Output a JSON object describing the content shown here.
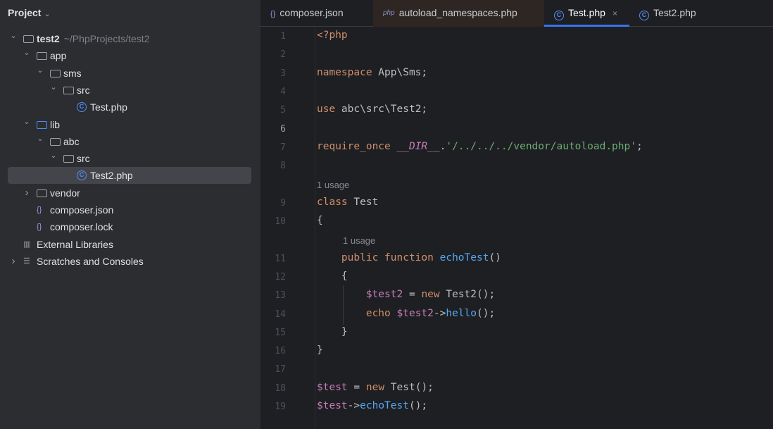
{
  "sidebar": {
    "title": "Project",
    "tree": [
      {
        "label": "test2",
        "hint": "~/PhpProjects/test2",
        "icon": "folder",
        "depth": 0,
        "arrow": "down",
        "bold": true
      },
      {
        "label": "app",
        "icon": "folder",
        "depth": 1,
        "arrow": "down"
      },
      {
        "label": "sms",
        "icon": "folder",
        "depth": 2,
        "arrow": "down"
      },
      {
        "label": "src",
        "icon": "folder",
        "depth": 3,
        "arrow": "down"
      },
      {
        "label": "Test.php",
        "icon": "php-class",
        "depth": 4
      },
      {
        "label": "lib",
        "icon": "folder-blue",
        "depth": 1,
        "arrow": "down"
      },
      {
        "label": "abc",
        "icon": "folder",
        "depth": 2,
        "arrow": "down"
      },
      {
        "label": "src",
        "icon": "folder",
        "depth": 3,
        "arrow": "down"
      },
      {
        "label": "Test2.php",
        "icon": "php-class",
        "depth": 4,
        "selected": true
      },
      {
        "label": "vendor",
        "icon": "folder",
        "depth": 1,
        "arrow": "right"
      },
      {
        "label": "composer.json",
        "icon": "json",
        "depth": 1
      },
      {
        "label": "composer.lock",
        "icon": "json",
        "depth": 1
      },
      {
        "label": "External Libraries",
        "icon": "library",
        "depth": 0
      },
      {
        "label": "Scratches and Consoles",
        "icon": "scratches",
        "depth": 0,
        "arrow": "right"
      }
    ]
  },
  "tabs": [
    {
      "label": "composer.json",
      "icon": "json"
    },
    {
      "label": "autoload_namespaces.php",
      "icon": "php"
    },
    {
      "label": "Test.php",
      "icon": "php-class",
      "active": true,
      "close": "×"
    },
    {
      "label": "Test2.php",
      "icon": "php-class"
    }
  ],
  "editor": {
    "current_line": "6",
    "lines": [
      {
        "n": "1",
        "t": [
          [
            "kw",
            "<?php"
          ]
        ]
      },
      {
        "n": "2",
        "t": []
      },
      {
        "n": "3",
        "t": [
          [
            "kw",
            "namespace"
          ],
          [
            "tx",
            " App\\Sms;"
          ]
        ]
      },
      {
        "n": "4",
        "t": []
      },
      {
        "n": "5",
        "t": [
          [
            "kw",
            "use"
          ],
          [
            "tx",
            " abc\\src\\Test2;"
          ]
        ]
      },
      {
        "n": "6",
        "t": []
      },
      {
        "n": "7",
        "t": [
          [
            "kw",
            "require_once"
          ],
          [
            "tx",
            " "
          ],
          [
            "const",
            "__DIR__"
          ],
          [
            "tx",
            "."
          ],
          [
            "str",
            "'/../../../vendor/autoload.php'"
          ],
          [
            "tx",
            ";"
          ]
        ]
      },
      {
        "n": "8",
        "t": []
      },
      {
        "usage": "1 usage",
        "indent": 0
      },
      {
        "n": "9",
        "t": [
          [
            "kw",
            "class"
          ],
          [
            "tx",
            " Test"
          ]
        ]
      },
      {
        "n": "10",
        "t": [
          [
            "tx",
            "{"
          ]
        ]
      },
      {
        "usage": "1 usage",
        "indent": 1
      },
      {
        "n": "11",
        "t": [
          [
            "tx",
            "    "
          ],
          [
            "kw",
            "public function"
          ],
          [
            "tx",
            " "
          ],
          [
            "fn",
            "echoTest"
          ],
          [
            "tx",
            "()"
          ]
        ]
      },
      {
        "n": "12",
        "t": [
          [
            "tx",
            "    {"
          ]
        ]
      },
      {
        "n": "13",
        "t": [
          [
            "tx",
            "        "
          ],
          [
            "var",
            "$test2"
          ],
          [
            "tx",
            " = "
          ],
          [
            "kw",
            "new"
          ],
          [
            "tx",
            " Test2();"
          ]
        ]
      },
      {
        "n": "14",
        "t": [
          [
            "tx",
            "        "
          ],
          [
            "kw",
            "echo"
          ],
          [
            "tx",
            " "
          ],
          [
            "var",
            "$test2"
          ],
          [
            "tx",
            "->"
          ],
          [
            "fn",
            "hello"
          ],
          [
            "tx",
            "();"
          ]
        ]
      },
      {
        "n": "15",
        "t": [
          [
            "tx",
            "    }"
          ]
        ]
      },
      {
        "n": "16",
        "t": [
          [
            "tx",
            "}"
          ]
        ]
      },
      {
        "n": "17",
        "t": []
      },
      {
        "n": "18",
        "t": [
          [
            "var",
            "$test"
          ],
          [
            "tx",
            " = "
          ],
          [
            "kw",
            "new"
          ],
          [
            "tx",
            " Test();"
          ]
        ]
      },
      {
        "n": "19",
        "t": [
          [
            "var",
            "$test"
          ],
          [
            "tx",
            "->"
          ],
          [
            "fn",
            "echoTest"
          ],
          [
            "tx",
            "();"
          ]
        ]
      }
    ]
  },
  "colors": {
    "accent": "#3574f0",
    "keyword": "#cf8e6d",
    "variable": "#c77dbb",
    "function": "#56a8f5",
    "string": "#6aab73"
  }
}
